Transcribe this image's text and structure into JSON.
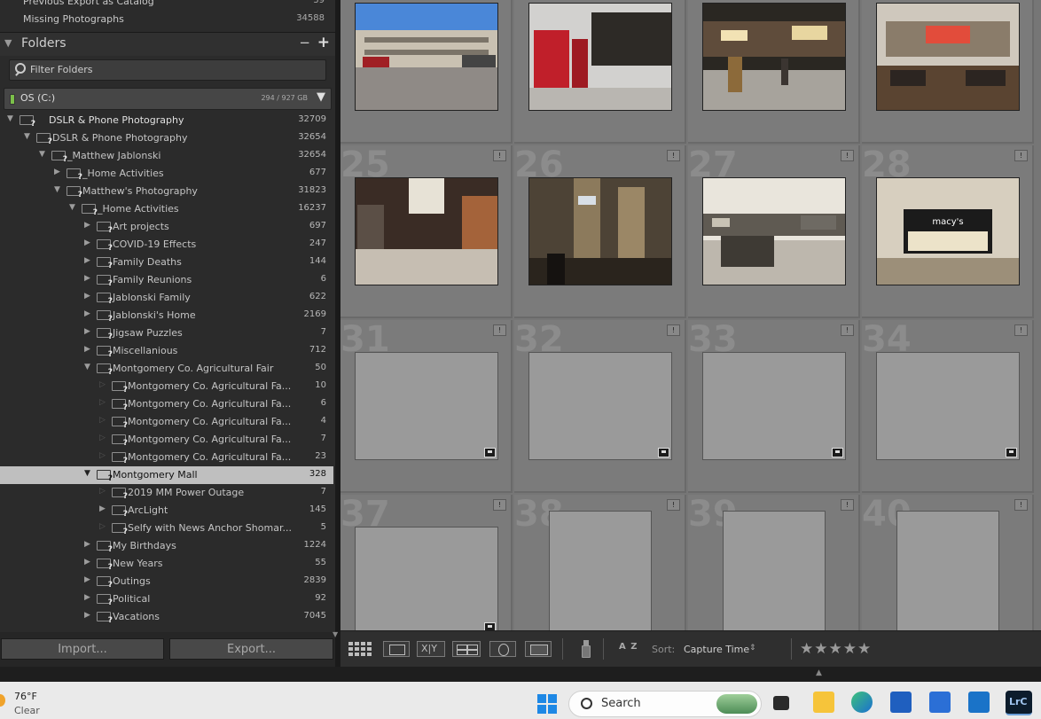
{
  "catalog": {
    "items": [
      {
        "label": "Previous Export as Catalog",
        "count": "39"
      },
      {
        "label": "Missing Photographs",
        "count": "34588"
      }
    ]
  },
  "folders": {
    "title": "Folders",
    "minus_icon": "−",
    "plus_icon": "+",
    "filter_placeholder": "Filter Folders",
    "volume": {
      "name": "OS (C:)",
      "space": "294 / 927 GB",
      "status_color": "#7cc04a"
    },
    "tree": [
      {
        "name": "DSLR & Phone Photography",
        "count": "32709",
        "level": 0,
        "state": "open",
        "root": true
      },
      {
        "name": "DSLR & Phone Photography",
        "count": "32654",
        "level": 1,
        "state": "open"
      },
      {
        "name": "_Matthew Jablonski",
        "count": "32654",
        "level": 2,
        "state": "open"
      },
      {
        "name": "_Home Activities",
        "count": "677",
        "level": 3,
        "state": "closed"
      },
      {
        "name": "Matthew's Photography",
        "count": "31823",
        "level": 3,
        "state": "open"
      },
      {
        "name": "_Home Activities",
        "count": "16237",
        "level": 4,
        "state": "open"
      },
      {
        "name": "Art projects",
        "count": "697",
        "level": 5,
        "state": "closed"
      },
      {
        "name": "COVID-19 Effects",
        "count": "247",
        "level": 5,
        "state": "closed"
      },
      {
        "name": "Family Deaths",
        "count": "144",
        "level": 5,
        "state": "closed"
      },
      {
        "name": "Family Reunions",
        "count": "6",
        "level": 5,
        "state": "closed"
      },
      {
        "name": "Jablonski Family",
        "count": "622",
        "level": 5,
        "state": "closed"
      },
      {
        "name": "Jablonski's Home",
        "count": "2169",
        "level": 5,
        "state": "closed"
      },
      {
        "name": "Jigsaw Puzzles",
        "count": "7",
        "level": 5,
        "state": "closed"
      },
      {
        "name": "Miscellanious",
        "count": "712",
        "level": 5,
        "state": "closed"
      },
      {
        "name": "Montgomery Co. Agricultural Fair",
        "count": "50",
        "level": 5,
        "state": "open"
      },
      {
        "name": "Montgomery Co. Agricultural Fa...",
        "count": "10",
        "level": 6,
        "state": "leaf"
      },
      {
        "name": "Montgomery Co. Agricultural Fa...",
        "count": "6",
        "level": 6,
        "state": "leaf"
      },
      {
        "name": "Montgomery Co. Agricultural Fa...",
        "count": "4",
        "level": 6,
        "state": "leaf"
      },
      {
        "name": "Montgomery Co. Agricultural Fa...",
        "count": "7",
        "level": 6,
        "state": "leaf"
      },
      {
        "name": "Montgomery Co. Agricultural Fa...",
        "count": "23",
        "level": 6,
        "state": "leaf"
      },
      {
        "name": "Montgomery Mall",
        "count": "328",
        "level": 5,
        "state": "open",
        "selected": true
      },
      {
        "name": "2019 MM Power Outage",
        "count": "7",
        "level": 6,
        "state": "leaf"
      },
      {
        "name": "ArcLight",
        "count": "145",
        "level": 6,
        "state": "closed"
      },
      {
        "name": "Selfy with News Anchor Shomar...",
        "count": "5",
        "level": 6,
        "state": "leaf"
      },
      {
        "name": "My Birthdays",
        "count": "1224",
        "level": 5,
        "state": "closed"
      },
      {
        "name": "New Years",
        "count": "55",
        "level": 5,
        "state": "closed"
      },
      {
        "name": "Outings",
        "count": "2839",
        "level": 5,
        "state": "closed"
      },
      {
        "name": "Political",
        "count": "92",
        "level": 5,
        "state": "closed"
      },
      {
        "name": "Vacations",
        "count": "7045",
        "level": 5,
        "state": "closed"
      }
    ]
  },
  "buttons": {
    "import": "Import...",
    "export": "Export..."
  },
  "grid": {
    "cells": [
      {
        "num": "",
        "kind": "photo",
        "scene": "parking-garage"
      },
      {
        "num": "",
        "kind": "photo",
        "scene": "mall-corridor-red-doors"
      },
      {
        "num": "",
        "kind": "photo",
        "scene": "food-court-crowd"
      },
      {
        "num": "",
        "kind": "photo",
        "scene": "food-court-tables"
      },
      {
        "num": "25",
        "kind": "photo",
        "scene": "mall-hallway"
      },
      {
        "num": "26",
        "kind": "photo",
        "scene": "mall-dim-atrium"
      },
      {
        "num": "27",
        "kind": "photo",
        "scene": "mall-upper-level"
      },
      {
        "num": "28",
        "kind": "photo",
        "scene": "macys-entrance",
        "caption": "macy's"
      },
      {
        "num": "31",
        "kind": "empty-landscape"
      },
      {
        "num": "32",
        "kind": "empty-landscape"
      },
      {
        "num": "33",
        "kind": "empty-landscape"
      },
      {
        "num": "34",
        "kind": "empty-landscape"
      },
      {
        "num": "37",
        "kind": "empty-landscape"
      },
      {
        "num": "38",
        "kind": "empty-portrait"
      },
      {
        "num": "39",
        "kind": "empty-portrait"
      },
      {
        "num": "40",
        "kind": "empty-portrait"
      }
    ],
    "flag_glyph": "!"
  },
  "toolbar": {
    "icons": [
      "grid-view-icon",
      "loupe-view-icon",
      "compare-view-icon",
      "survey-view-icon",
      "people-view-icon",
      "slideshow-icon",
      "spray-can-icon",
      "sort-direction-icon"
    ],
    "compare_label": "X|Y",
    "sort_az": "A Z",
    "sort_label": "Sort:",
    "sort_value": "Capture Time",
    "stars": "★★★★★"
  },
  "taskbar": {
    "temp": "76°F",
    "weather": "Clear",
    "search": "Search",
    "app_label": "LrC"
  }
}
